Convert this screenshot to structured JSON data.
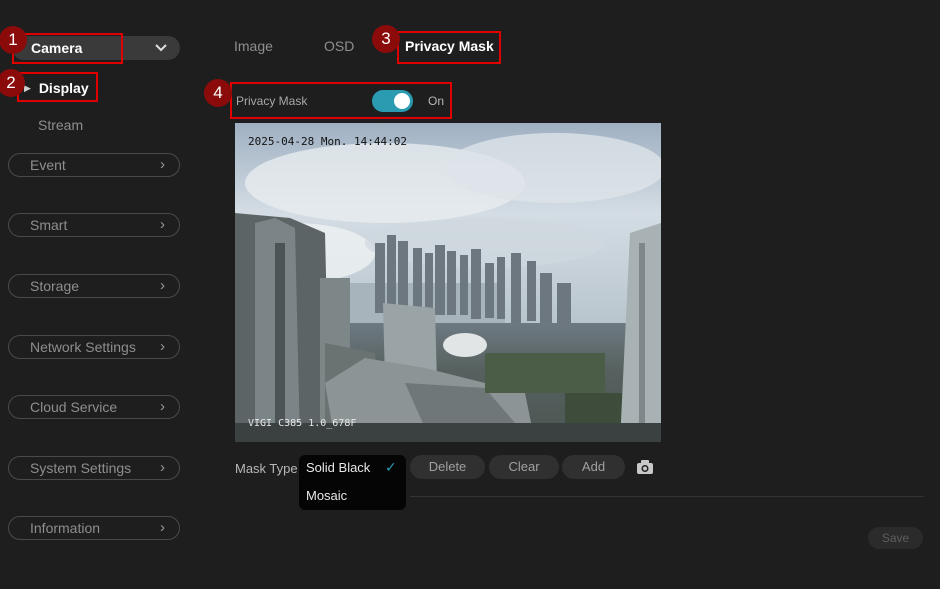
{
  "sidebar": {
    "camera_label": "Camera",
    "display_label": "Display",
    "stream_label": "Stream",
    "items": [
      {
        "label": "Event"
      },
      {
        "label": "Smart"
      },
      {
        "label": "Storage"
      },
      {
        "label": "Network Settings"
      },
      {
        "label": "Cloud Service"
      },
      {
        "label": "System Settings"
      },
      {
        "label": "Information"
      }
    ]
  },
  "tabs": [
    {
      "label": "Image"
    },
    {
      "label": "OSD"
    },
    {
      "label": "Privacy Mask",
      "active": true
    }
  ],
  "privacy": {
    "label": "Privacy Mask",
    "state": "On",
    "enabled": true
  },
  "camera": {
    "timestamp": "2025-04-28 Mon. 14:44:02",
    "model": "VIGI C385 1.0_678F"
  },
  "mask": {
    "label": "Mask Type",
    "options": [
      {
        "label": "Solid Black",
        "selected": true
      },
      {
        "label": "Mosaic"
      }
    ],
    "buttons": {
      "delete": "Delete",
      "clear": "Clear",
      "add": "Add"
    }
  },
  "footer": {
    "save_label": "Save"
  },
  "callouts": [
    "1",
    "2",
    "3",
    "4"
  ],
  "colors": {
    "background": "#1e1e1e",
    "accent": "#2a9bb0",
    "callout": "#e00000"
  },
  "icons": {
    "chevron": "chevron-right-icon",
    "snapshot": "camera-icon"
  }
}
